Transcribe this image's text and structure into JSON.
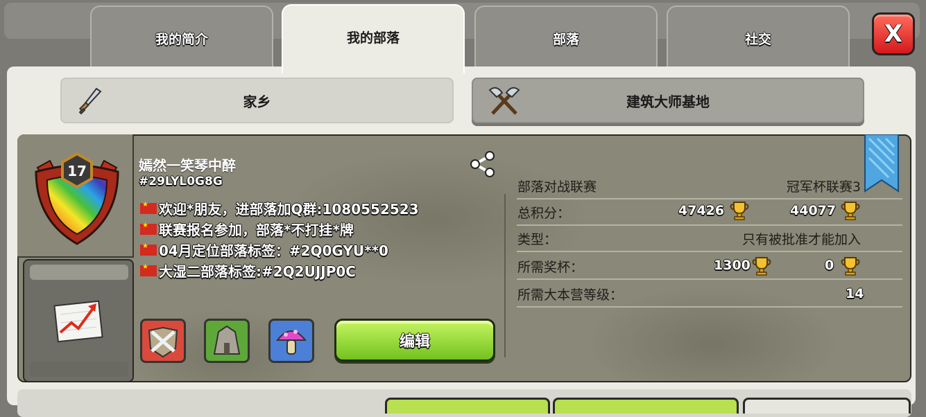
{
  "tabs": [
    {
      "label": "我的简介",
      "active": false
    },
    {
      "label": "我的部落",
      "active": true
    },
    {
      "label": "部落",
      "active": false
    },
    {
      "label": "社交",
      "active": false
    }
  ],
  "close_label": "X",
  "subtabs": {
    "home": "家乡",
    "builder": "建筑大师基地"
  },
  "clan": {
    "level": "17",
    "name": "嫣然一笑琴中醉",
    "tag": "#29LYL0G8G",
    "description": [
      "欢迎*朋友，进部落加Q群:1080552523",
      "联赛报名参加，部落*不打挂*牌",
      "04月定位部落标签：#2Q0GYU**0",
      "大湿二部落标签:#2Q2UJJP0C"
    ]
  },
  "edit_label": "编辑",
  "info": {
    "war_league_label": "部落对战联赛",
    "war_league_value": "冠军杯联赛3",
    "total_points_label": "总积分：",
    "total_points_home": "47426",
    "total_points_builder": "44077",
    "type_label": "类型：",
    "type_value": "只有被批准才能加入",
    "required_trophies_label": "所需奖杯：",
    "required_trophies_home": "1300",
    "required_trophies_builder": "0",
    "required_th_label": "所需大本营等级：",
    "required_th_value": "14"
  },
  "colors": {
    "accent_green": "#7ccd22",
    "close_red": "#e0251f",
    "panel_bg": "#ecebe4",
    "card_bg": "#8a8878"
  },
  "icons": [
    "sword-icon",
    "axes-icon",
    "share-icon",
    "trophy-icon",
    "ribbon-icon",
    "chart-icon",
    "clan-badge-icon"
  ]
}
